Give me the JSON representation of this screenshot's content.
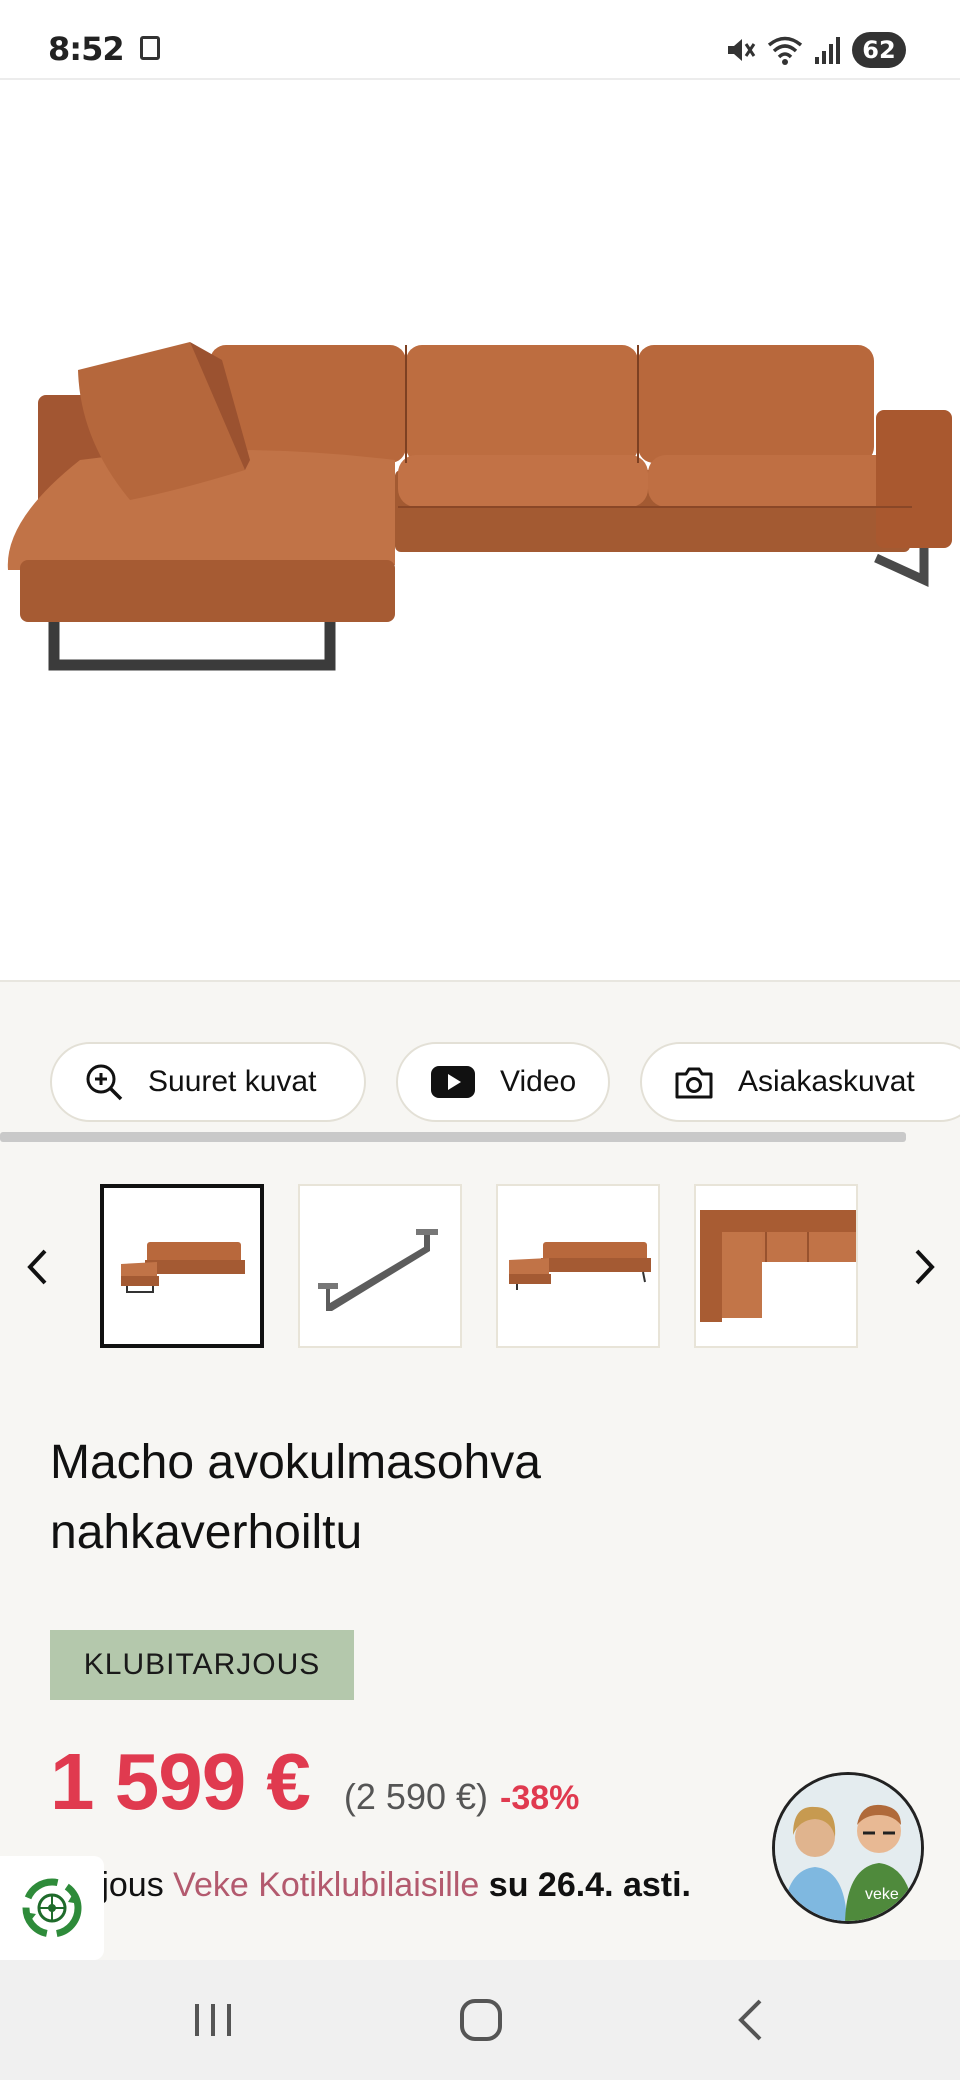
{
  "status_bar": {
    "time": "8:52",
    "battery": "62",
    "icons": [
      "gallery-icon",
      "mute-icon",
      "wifi-icon",
      "signal-icon",
      "battery-icon"
    ]
  },
  "hero": {
    "image": "leather-corner-sofa-photo"
  },
  "actions": {
    "zoom_label": "Suuret kuvat",
    "video_label": "Video",
    "photos_label": "Asiakaskuvat"
  },
  "thumbnails": [
    {
      "name": "sofa-front-view",
      "active": true
    },
    {
      "name": "leg-bracket",
      "active": false
    },
    {
      "name": "sofa-angle-view",
      "active": false
    },
    {
      "name": "sofa-top-view",
      "active": false
    }
  ],
  "product": {
    "title_line1": "Macho avokulmasohva",
    "title_line2": "nahkaverhoiltu",
    "badge": "KLUBITARJOUS",
    "price": "1 599 €",
    "original_price": "(2 590 €)",
    "discount": "-38%",
    "offer_prefix": "rjous",
    "offer_link": "Veke Kotiklubilaisille",
    "offer_date": "su 26.4. asti."
  },
  "chat": {
    "avatar_logo": "veke"
  },
  "colors": {
    "price_red": "#e03a4f",
    "badge_green": "#b4c8ac",
    "link_pink": "#b35a6e",
    "leather": "#b8683c"
  }
}
